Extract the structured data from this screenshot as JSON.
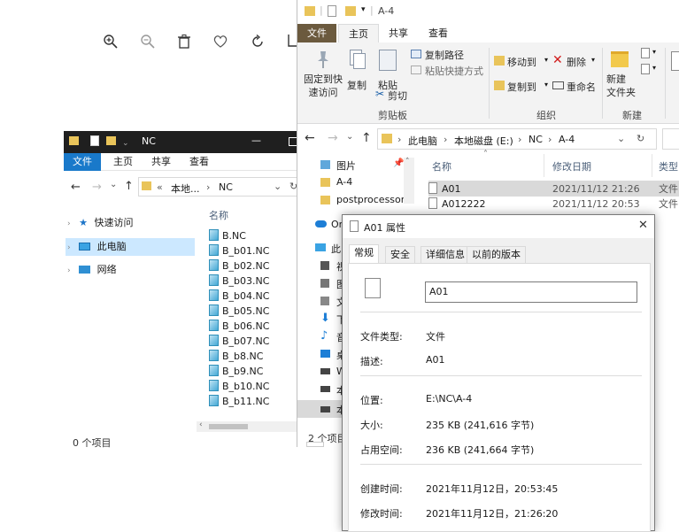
{
  "photo_toolbar": {
    "icons": [
      "zoom-in-icon",
      "zoom-out-icon",
      "delete-icon",
      "heart-icon",
      "rotate-icon",
      "crop-icon"
    ]
  },
  "left_window": {
    "title": "NC",
    "tabs": [
      "文件",
      "主页",
      "共享",
      "查看"
    ],
    "address": [
      "«",
      "本地...",
      "›",
      "NC"
    ],
    "nav": [
      {
        "label": "快速访问",
        "icon": "star-icon"
      },
      {
        "label": "此电脑",
        "icon": "computer-icon"
      },
      {
        "label": "网络",
        "icon": "network-icon"
      }
    ],
    "column_header": "名称",
    "files": [
      "B.NC",
      "B_b01.NC",
      "B_b02.NC",
      "B_b03.NC",
      "B_b04.NC",
      "B_b05.NC",
      "B_b06.NC",
      "B_b07.NC",
      "B_b8.NC",
      "B_b9.NC",
      "B_b10.NC",
      "B_b11.NC"
    ],
    "status": "0 个项目"
  },
  "main_window": {
    "title": "A-4",
    "tabs": [
      "文件",
      "主页",
      "共享",
      "查看"
    ],
    "ribbon": {
      "pin_label": "固定到快\n速访问",
      "copy_label": "复制",
      "paste_label": "粘贴",
      "copy_path": "复制路径",
      "paste_shortcut": "粘贴快捷方式",
      "cut": "剪切",
      "clipboard_group": "剪贴板",
      "move_to": "移动到",
      "copy_to": "复制到",
      "delete": "删除",
      "rename": "重命名",
      "organize_group": "组织",
      "new_folder": "新建\n文件夹",
      "new_group": "新建"
    },
    "address": [
      "此电脑",
      "›",
      "本地磁盘 (E:)",
      "›",
      "NC",
      "›",
      "A-4"
    ],
    "nav": [
      "图片",
      "A-4",
      "postprocessor",
      "On",
      "此",
      "视",
      "图",
      "文",
      "下",
      "音",
      "桌",
      "W",
      "本",
      "本"
    ],
    "columns": [
      "名称",
      "修改日期",
      "类型"
    ],
    "rows": [
      {
        "name": "A01",
        "date": "2021/11/12 21:26",
        "type": "文件"
      },
      {
        "name": "A012222",
        "date": "2021/11/12 20:53",
        "type": "文件"
      }
    ],
    "status": "2 个项目"
  },
  "properties": {
    "title": "A01 属性",
    "tabs": [
      "常规",
      "安全",
      "详细信息",
      "以前的版本"
    ],
    "name_value": "A01",
    "fields": [
      {
        "label": "文件类型:",
        "value": "文件"
      },
      {
        "label": "描述:",
        "value": "A01"
      },
      {
        "label": "位置:",
        "value": "E:\\NC\\A-4"
      },
      {
        "label": "大小:",
        "value": "235 KB (241,616 字节)"
      },
      {
        "label": "占用空间:",
        "value": "236 KB (241,664 字节)"
      },
      {
        "label": "创建时间:",
        "value": "2021年11月12日，20:53:45"
      },
      {
        "label": "修改时间:",
        "value": "2021年11月12日，21:26:20"
      }
    ]
  }
}
